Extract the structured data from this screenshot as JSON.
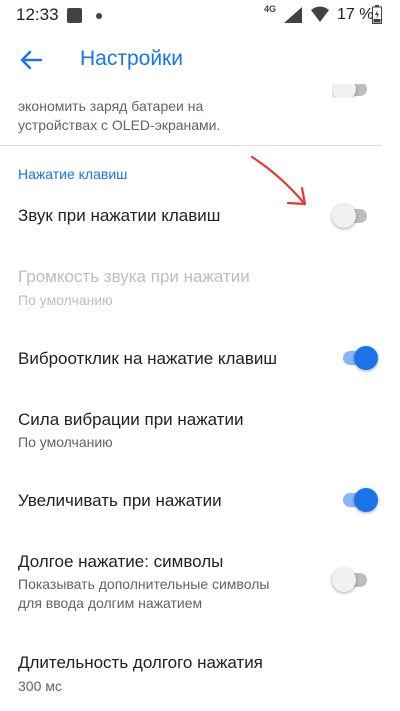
{
  "status_bar": {
    "time": "12:33",
    "network": "4G",
    "battery_percent": "17 %"
  },
  "app_bar": {
    "title": "Настройки"
  },
  "cut_item": {
    "line1": "экономить заряд батареи на",
    "line2": "устройствах с OLED-экранами.",
    "switch_on": false
  },
  "section": {
    "header": "Нажатие клавиш"
  },
  "items": [
    {
      "title": "Звук при нажатии клавиш",
      "summary": "",
      "switch_on": false,
      "enabled": true
    },
    {
      "title": "Громкость звука при нажатии",
      "summary": "По умолчанию",
      "enabled": false
    },
    {
      "title": "Виброотклик на нажатие клавиш",
      "summary": "",
      "switch_on": true,
      "enabled": true
    },
    {
      "title": "Сила вибрации при нажатии",
      "summary": "По умолчанию",
      "enabled": true
    },
    {
      "title": "Увеличивать при нажатии",
      "summary": "",
      "switch_on": true,
      "enabled": true
    },
    {
      "title": "Долгое нажатие: символы",
      "summary_line1": "Показывать дополнительные символы",
      "summary_line2": "для ввода долгим нажатием",
      "switch_on": false,
      "enabled": true
    },
    {
      "title": "Длительность долгого нажатия",
      "summary": "300 мс",
      "enabled": true
    }
  ],
  "colors": {
    "accent": "#1a73e8",
    "annotation": "#e53935"
  }
}
